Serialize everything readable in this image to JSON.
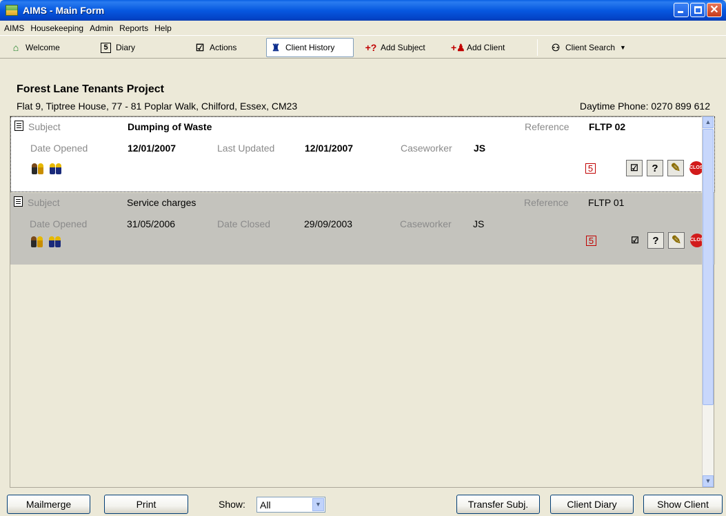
{
  "window": {
    "title": "AIMS - Main Form"
  },
  "menu": [
    "AIMS",
    "Housekeeping",
    "Admin",
    "Reports",
    "Help"
  ],
  "toolbar": {
    "welcome": "Welcome",
    "diary": "Diary",
    "diary_icon_text": "5",
    "actions": "Actions",
    "client_history": "Client History",
    "add_subject": "Add Subject",
    "add_client": "Add Client",
    "client_search": "Client Search"
  },
  "client": {
    "name": "Forest Lane Tenants Project",
    "address": "Flat 9, Tiptree House, 77 - 81 Poplar Walk, Chilford, Essex, CM23",
    "phone": "Daytime Phone: 0270 899 612"
  },
  "labels": {
    "subject": "Subject",
    "reference": "Reference",
    "date_opened": "Date Opened",
    "last_updated": "Last Updated",
    "date_closed": "Date Closed",
    "caseworker": "Caseworker",
    "help_q": "?",
    "transfer_num": "5",
    "stop": "CLOSE"
  },
  "subjects": [
    {
      "subject": "Dumping of Waste",
      "reference": "FLTP 02",
      "date_opened": "12/01/2007",
      "secondary_date": "12/01/2007",
      "caseworker": "JS",
      "status": "open"
    },
    {
      "subject": "Service charges",
      "reference": "FLTP 01",
      "date_opened": "31/05/2006",
      "secondary_date": "29/09/2003",
      "caseworker": "JS",
      "status": "closed"
    }
  ],
  "footer": {
    "mailmerge": "Mailmerge",
    "print": "Print",
    "show_label": "Show:",
    "show_value": "All",
    "transfer": "Transfer Subj.",
    "client_diary": "Client Diary",
    "show_client": "Show Client"
  },
  "colors": {
    "titlebar": "#0758e0",
    "selected_card": "#ffffff",
    "closed_card": "#c4c3bd",
    "window_bg": "#ece9d8"
  }
}
